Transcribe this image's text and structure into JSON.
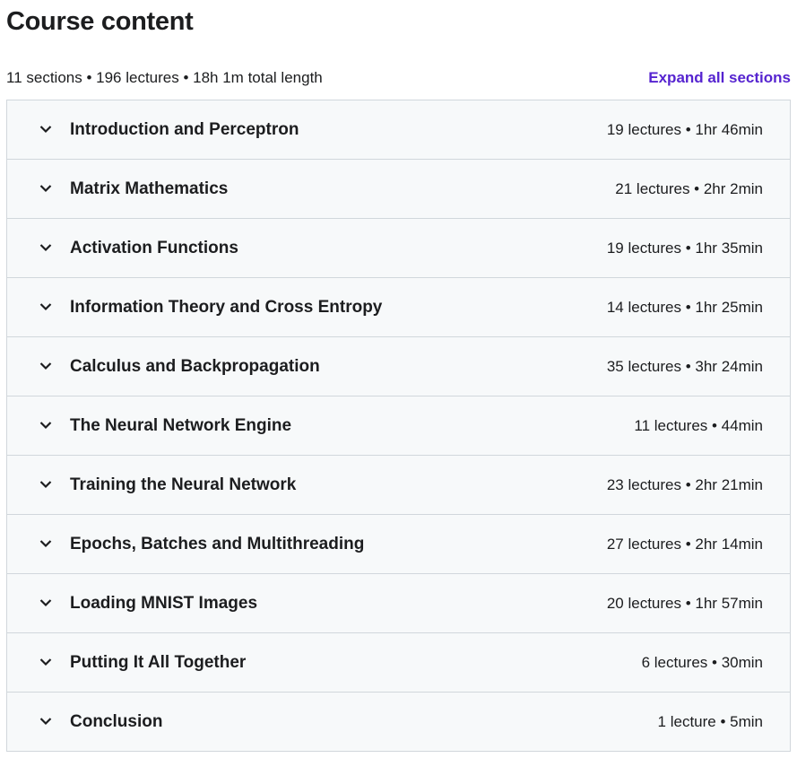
{
  "header": {
    "title": "Course content",
    "summary": "11 sections • 196 lectures • 18h 1m total length",
    "expand_label": "Expand all sections"
  },
  "colors": {
    "accent": "#5624d0",
    "row_bg": "#f7f9fa",
    "border": "#d1d7dc"
  },
  "sections": [
    {
      "title": "Introduction and Perceptron",
      "meta": "19 lectures • 1hr 46min",
      "icon": "chevron-down-icon"
    },
    {
      "title": "Matrix Mathematics",
      "meta": "21 lectures • 2hr 2min",
      "icon": "chevron-down-icon"
    },
    {
      "title": "Activation Functions",
      "meta": "19 lectures • 1hr 35min",
      "icon": "chevron-down-icon"
    },
    {
      "title": "Information Theory and Cross Entropy",
      "meta": "14 lectures • 1hr 25min",
      "icon": "chevron-down-icon"
    },
    {
      "title": "Calculus and Backpropagation",
      "meta": "35 lectures • 3hr 24min",
      "icon": "chevron-down-icon"
    },
    {
      "title": "The Neural Network Engine",
      "meta": "11 lectures • 44min",
      "icon": "chevron-down-icon"
    },
    {
      "title": "Training the Neural Network",
      "meta": "23 lectures • 2hr 21min",
      "icon": "chevron-down-icon"
    },
    {
      "title": "Epochs, Batches and Multithreading",
      "meta": "27 lectures • 2hr 14min",
      "icon": "chevron-down-icon"
    },
    {
      "title": "Loading MNIST Images",
      "meta": "20 lectures • 1hr 57min",
      "icon": "chevron-down-icon"
    },
    {
      "title": "Putting It All Together",
      "meta": "6 lectures • 30min",
      "icon": "chevron-down-icon"
    },
    {
      "title": "Conclusion",
      "meta": "1 lecture • 5min",
      "icon": "chevron-down-icon"
    }
  ]
}
